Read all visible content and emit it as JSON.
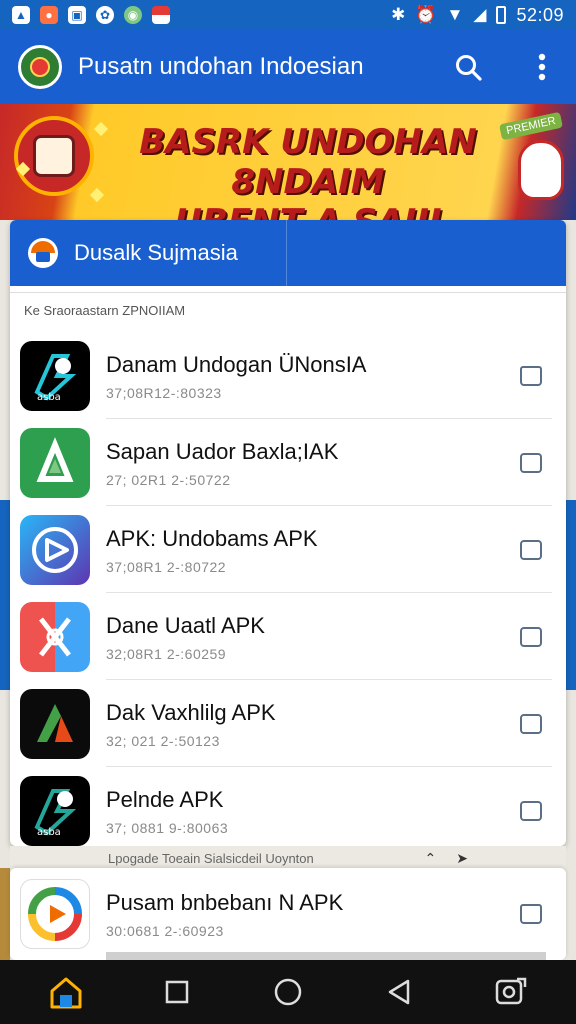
{
  "status_bar": {
    "left_icons": [
      "notification-icon",
      "app-icon",
      "image-icon",
      "settings-icon",
      "vpn-icon",
      "flag-icon"
    ],
    "time": "52:09"
  },
  "app_bar": {
    "title": "Pusatn undohan Indoesian"
  },
  "banner": {
    "line1": "BASRK UNDOHAN 8NDAIM",
    "line2": "UBENT A SAIII CHGHAIR!",
    "tag": "PREMIER"
  },
  "card": {
    "title": "Dusalk Sujmasia",
    "section_label": "Ke Sraoraastarn ZPNOIIAM"
  },
  "apps": [
    {
      "title": "Danam Undogan ÜNonsIA",
      "subtitle": "37;08R12-:80323",
      "bg": "#000000",
      "icon": "stylized-s-icon",
      "checkbox": "folder"
    },
    {
      "title": "Sapan Uador Baxla;IAK",
      "subtitle": "27; 02R1 2-:50722",
      "bg": "#2e9e4f",
      "icon": "triangle-play-icon",
      "checkbox": "square"
    },
    {
      "title": "APK: Undobams APK",
      "subtitle": "37;08R1 2-:80722",
      "bg": "#2196f3",
      "icon": "play-circle-icon",
      "checkbox": "square"
    },
    {
      "title": "Dane Uaatl APK",
      "subtitle": "32;08R1 2-:60259",
      "bg": "#2f8fe0",
      "icon": "wrench-icon",
      "checkbox": "square"
    },
    {
      "title": "Dak Vaxhlilg APK",
      "subtitle": "32; 021 2-:50123",
      "bg": "#0b0b0b",
      "icon": "green-triangle-icon",
      "checkbox": "square"
    },
    {
      "title": "Pelnde APK",
      "subtitle": "37; 0881 9-:80063",
      "bg": "#000000",
      "icon": "stylized-s-icon",
      "checkbox": "square"
    }
  ],
  "sub_header": {
    "text": "Lpogade Toeain Sialsicdeil Uoynton"
  },
  "app2": {
    "title": "Pusam bnbebanı N APK",
    "subtitle": "30:0681 2-:60923",
    "icon": "refresh-arrows-icon",
    "checkbox": "folder"
  },
  "colors": {
    "primary": "#1a5fd0",
    "nav": "#111111",
    "banner_text": "#b71c1c",
    "banner_bg": "#ffd54f"
  }
}
